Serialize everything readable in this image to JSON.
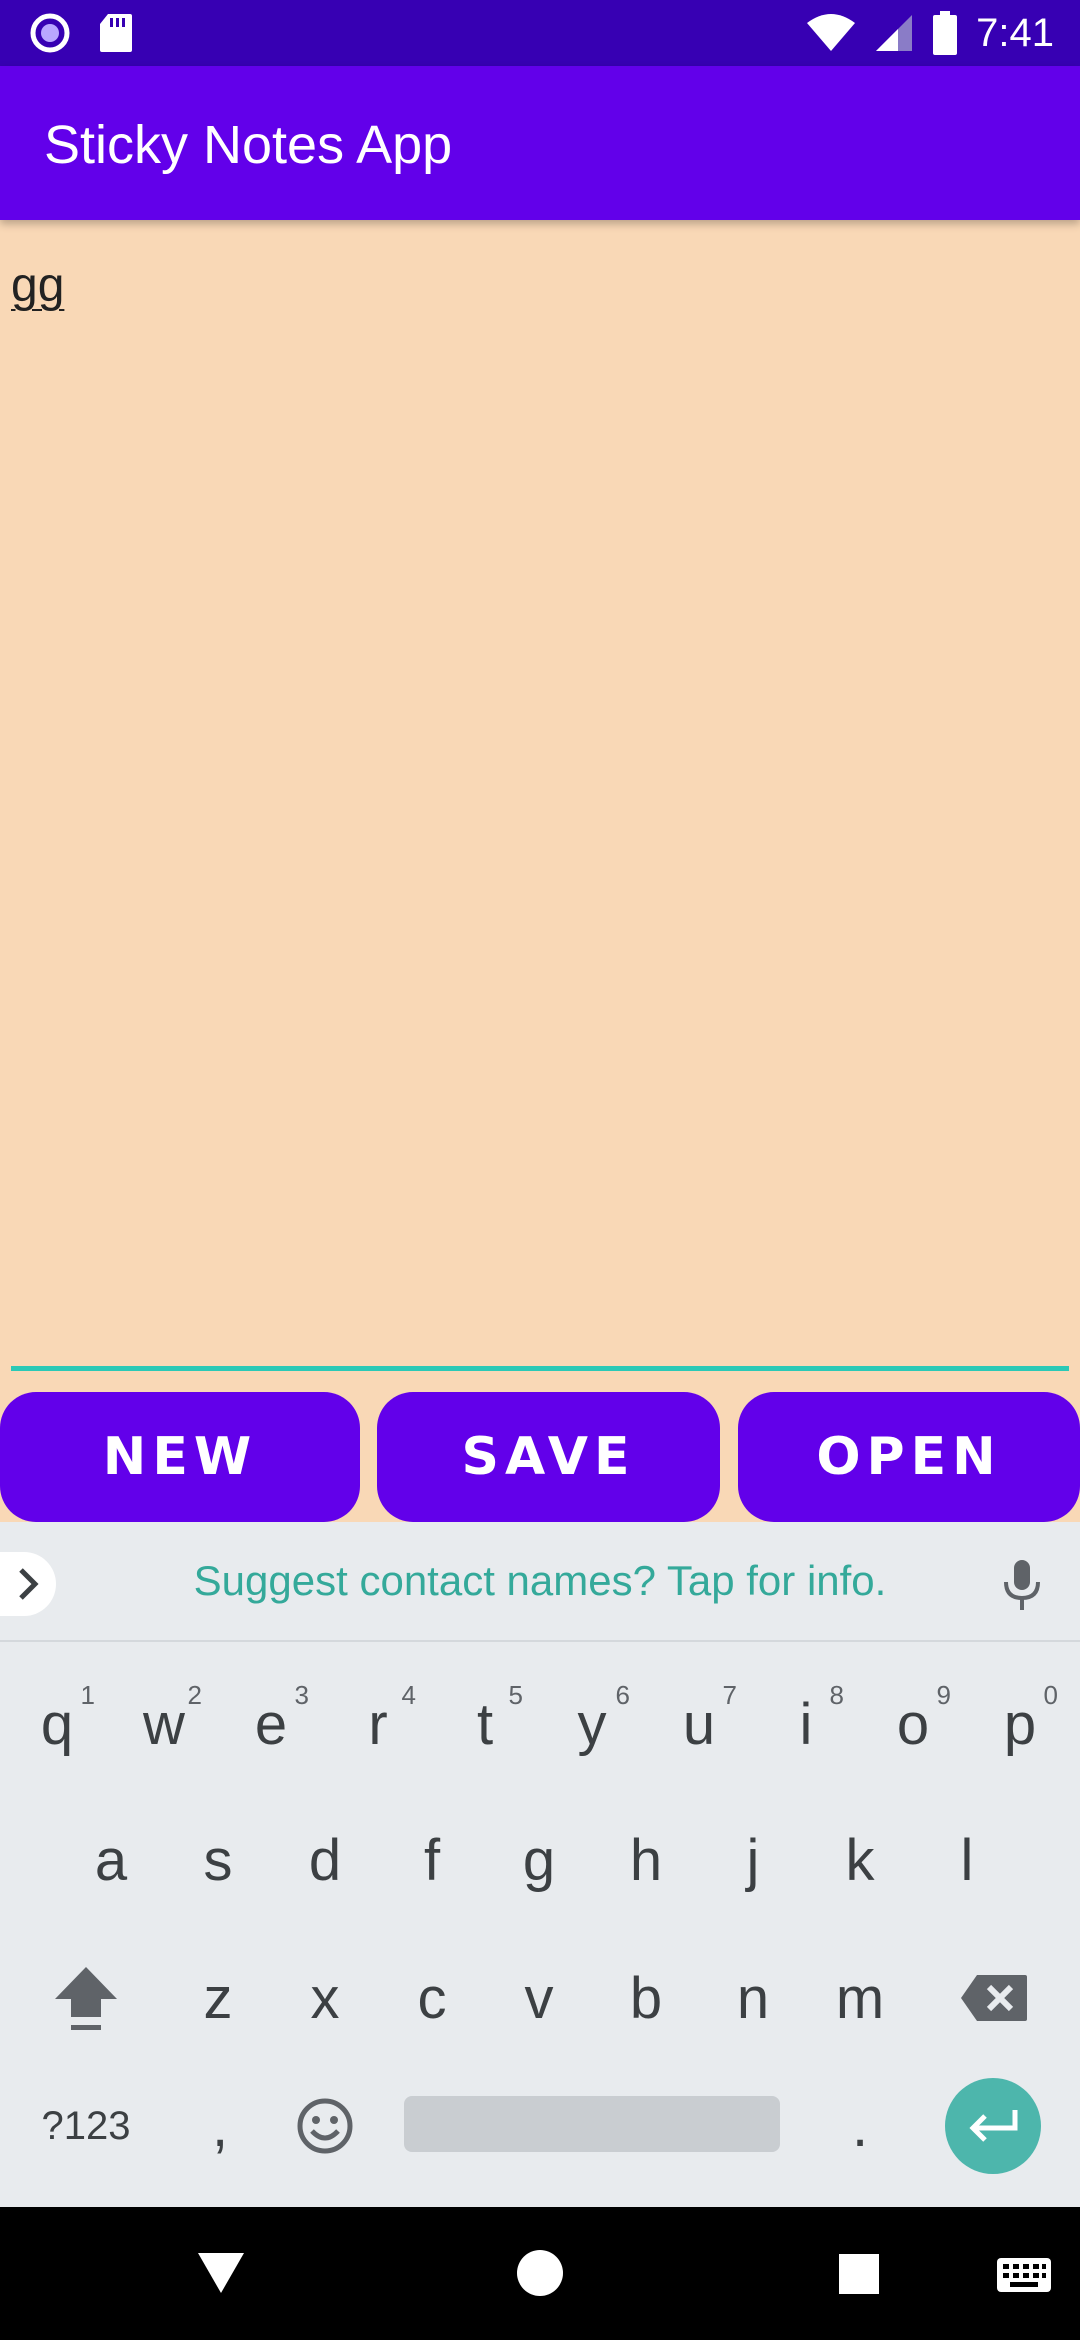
{
  "status_bar": {
    "time": "7:41"
  },
  "app_bar": {
    "title": "Sticky Notes App"
  },
  "editor": {
    "text": "gg"
  },
  "buttons": {
    "new": "NEW",
    "save": "SAVE",
    "open": "OPEN"
  },
  "keyboard": {
    "suggestion": "Suggest contact names? Tap for info.",
    "row1": [
      {
        "k": "q",
        "h": "1"
      },
      {
        "k": "w",
        "h": "2"
      },
      {
        "k": "e",
        "h": "3"
      },
      {
        "k": "r",
        "h": "4"
      },
      {
        "k": "t",
        "h": "5"
      },
      {
        "k": "y",
        "h": "6"
      },
      {
        "k": "u",
        "h": "7"
      },
      {
        "k": "i",
        "h": "8"
      },
      {
        "k": "o",
        "h": "9"
      },
      {
        "k": "p",
        "h": "0"
      }
    ],
    "row2": [
      "a",
      "s",
      "d",
      "f",
      "g",
      "h",
      "j",
      "k",
      "l"
    ],
    "row3": [
      "z",
      "x",
      "c",
      "v",
      "b",
      "n",
      "m"
    ],
    "symbols_label": "?123",
    "comma": ",",
    "period": "."
  },
  "colors": {
    "status_bar": "#3700b3",
    "accent": "#6200ea",
    "note_background": "#f9d8b6",
    "underline": "#2bc9b6",
    "enter_key": "#4db6ac"
  }
}
